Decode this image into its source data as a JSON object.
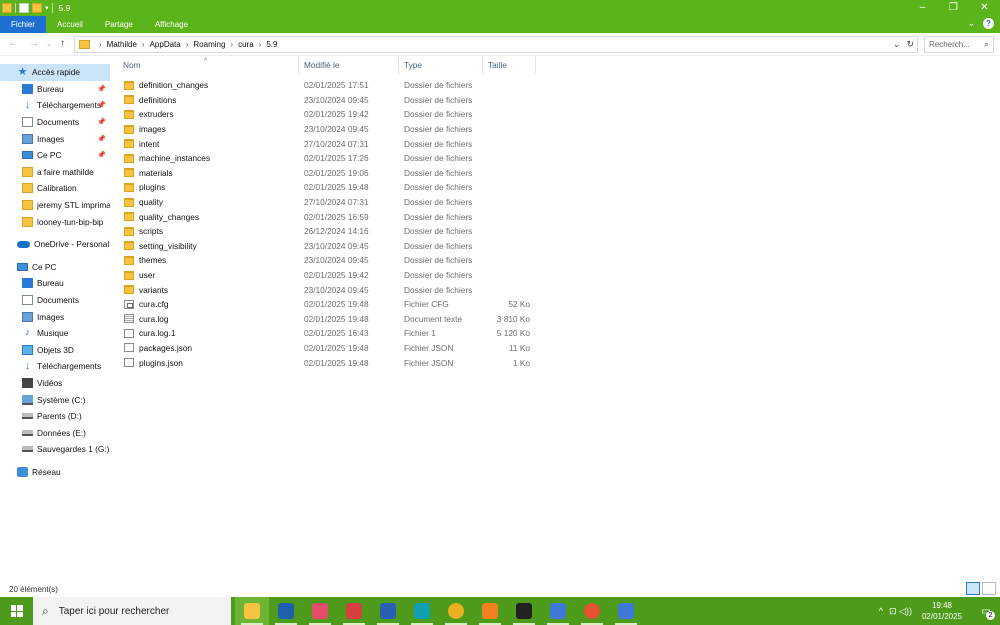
{
  "window": {
    "title": "5.9",
    "minimize": "–",
    "maximize": "❐",
    "close": "✕"
  },
  "ribbon": {
    "tabs": [
      {
        "label": "Fichier",
        "active": true
      },
      {
        "label": "Accueil"
      },
      {
        "label": "Partage"
      },
      {
        "label": "Affichage"
      }
    ],
    "expand_glyph": "⌄",
    "help_glyph": "?"
  },
  "address": {
    "back": "←",
    "forward": "→",
    "recent": "⌄",
    "up": "↑",
    "breadcrumbs": [
      "Mathilde",
      "AppData",
      "Roaming",
      "cura",
      "5.9"
    ],
    "separator": "›",
    "dropdown_glyph": "⌄",
    "refresh_glyph": "↻",
    "search_placeholder": "Recherch...",
    "search_glyph": "⌕"
  },
  "nav": {
    "quick_access": {
      "label": "Accès rapide",
      "items": [
        {
          "label": "Bureau",
          "icon": "desktop-icon",
          "pinned": true
        },
        {
          "label": "Téléchargements",
          "icon": "download-icon",
          "pinned": true
        },
        {
          "label": "Documents",
          "icon": "documents-icon",
          "pinned": true
        },
        {
          "label": "Images",
          "icon": "images-icon",
          "pinned": true
        },
        {
          "label": "Ce PC",
          "icon": "computer-icon",
          "pinned": true
        },
        {
          "label": "a faire mathilde",
          "icon": "folder-icon"
        },
        {
          "label": "Calibration",
          "icon": "folder-icon"
        },
        {
          "label": "jeremy STL imprima",
          "icon": "folder-icon"
        },
        {
          "label": "looney-tun-bip-bip",
          "icon": "folder-icon"
        }
      ]
    },
    "onedrive": "OneDrive - Personal",
    "this_pc": {
      "label": "Ce PC",
      "items": [
        {
          "label": "Bureau",
          "icon": "desktop-icon"
        },
        {
          "label": "Documents",
          "icon": "documents-icon"
        },
        {
          "label": "Images",
          "icon": "images-icon"
        },
        {
          "label": "Musique",
          "icon": "music-icon"
        },
        {
          "label": "Objets 3D",
          "icon": "objects-3d-icon"
        },
        {
          "label": "Téléchargements",
          "icon": "download-icon"
        },
        {
          "label": "Vidéos",
          "icon": "videos-icon"
        },
        {
          "label": "Système (C:)",
          "icon": "system-drive-icon"
        },
        {
          "label": "Parents (D:)",
          "icon": "drive-icon"
        },
        {
          "label": "Données (E:)",
          "icon": "drive-icon"
        },
        {
          "label": "Sauvegardes 1 (G:)",
          "icon": "drive-icon"
        }
      ]
    },
    "network": "Réseau",
    "pin_glyph": "📌"
  },
  "columns": {
    "name": "Nom",
    "modified": "Modifié le",
    "type": "Type",
    "size": "Taille",
    "sort_glyph": "^"
  },
  "files": [
    {
      "name": "definition_changes",
      "date": "02/01/2025 17:51",
      "type": "Dossier de fichiers",
      "size": "",
      "kind": "folder"
    },
    {
      "name": "definitions",
      "date": "23/10/2024 09:45",
      "type": "Dossier de fichiers",
      "size": "",
      "kind": "folder"
    },
    {
      "name": "extruders",
      "date": "02/01/2025 19:42",
      "type": "Dossier de fichiers",
      "size": "",
      "kind": "folder"
    },
    {
      "name": "images",
      "date": "23/10/2024 09:45",
      "type": "Dossier de fichiers",
      "size": "",
      "kind": "folder"
    },
    {
      "name": "intent",
      "date": "27/10/2024 07:31",
      "type": "Dossier de fichiers",
      "size": "",
      "kind": "folder"
    },
    {
      "name": "machine_instances",
      "date": "02/01/2025 17:26",
      "type": "Dossier de fichiers",
      "size": "",
      "kind": "folder"
    },
    {
      "name": "materials",
      "date": "02/01/2025 19:06",
      "type": "Dossier de fichiers",
      "size": "",
      "kind": "folder"
    },
    {
      "name": "plugins",
      "date": "02/01/2025 19:48",
      "type": "Dossier de fichiers",
      "size": "",
      "kind": "folder"
    },
    {
      "name": "quality",
      "date": "27/10/2024 07:31",
      "type": "Dossier de fichiers",
      "size": "",
      "kind": "folder"
    },
    {
      "name": "quality_changes",
      "date": "02/01/2025 16:59",
      "type": "Dossier de fichiers",
      "size": "",
      "kind": "folder"
    },
    {
      "name": "scripts",
      "date": "26/12/2024 14:16",
      "type": "Dossier de fichiers",
      "size": "",
      "kind": "folder"
    },
    {
      "name": "setting_visibility",
      "date": "23/10/2024 09:45",
      "type": "Dossier de fichiers",
      "size": "",
      "kind": "folder"
    },
    {
      "name": "themes",
      "date": "23/10/2024 09:45",
      "type": "Dossier de fichiers",
      "size": "",
      "kind": "folder"
    },
    {
      "name": "user",
      "date": "02/01/2025 19:42",
      "type": "Dossier de fichiers",
      "size": "",
      "kind": "folder"
    },
    {
      "name": "variants",
      "date": "23/10/2024 09:45",
      "type": "Dossier de fichiers",
      "size": "",
      "kind": "folder"
    },
    {
      "name": "cura.cfg",
      "date": "02/01/2025 19:48",
      "type": "Fichier CFG",
      "size": "52 Ko",
      "kind": "cfg"
    },
    {
      "name": "cura.log",
      "date": "02/01/2025 19:48",
      "type": "Document texte",
      "size": "3 810 Ko",
      "kind": "text"
    },
    {
      "name": "cura.log.1",
      "date": "02/01/2025 16:43",
      "type": "Fichier 1",
      "size": "5 120 Ko",
      "kind": "file"
    },
    {
      "name": "packages.json",
      "date": "02/01/2025 19:48",
      "type": "Fichier JSON",
      "size": "11 Ko",
      "kind": "file"
    },
    {
      "name": "plugins.json",
      "date": "02/01/2025 19:48",
      "type": "Fichier JSON",
      "size": "1 Ko",
      "kind": "file"
    }
  ],
  "status": {
    "count": "20 élément(s)"
  },
  "taskbar": {
    "search_placeholder": "Taper ici pour rechercher",
    "search_glyph": "⌕",
    "apps": [
      {
        "name": "file-explorer",
        "color": "#f6c342",
        "active": true
      },
      {
        "name": "calculator",
        "color": "#1e5fb0"
      },
      {
        "name": "paint-3d",
        "color": "#e84c6a"
      },
      {
        "name": "snipping-tool",
        "color": "#d84040"
      },
      {
        "name": "word",
        "color": "#2b5fb4"
      },
      {
        "name": "app-teal",
        "color": "#10a0b0"
      },
      {
        "name": "chrome",
        "color": "#e8b020"
      },
      {
        "name": "fusion-app",
        "color": "#f08020"
      },
      {
        "name": "cura",
        "color": "#222222"
      },
      {
        "name": "app-c-blue",
        "color": "#3f78d8"
      },
      {
        "name": "chrome-profile",
        "color": "#e85030"
      },
      {
        "name": "app-c-blue-2",
        "color": "#3f78d8"
      }
    ],
    "tray_chevron": "^",
    "tray_glyphs": "⊡ ◁))",
    "time": "19:48",
    "date": "02/01/2025",
    "notifications": "2"
  },
  "colors": {
    "accent_green": "#5bb419",
    "active_tab_blue": "#1e6fd2",
    "taskbar_green": "#4e9a1a",
    "selection": "#cce4f7"
  }
}
